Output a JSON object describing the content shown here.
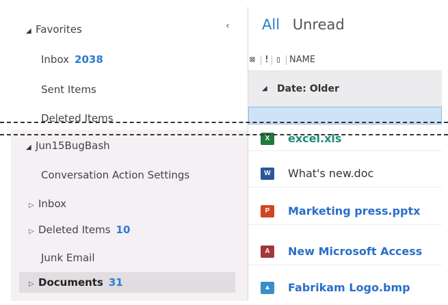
{
  "nav": {
    "collapse_glyph": "‹",
    "favorites_label": "Favorites",
    "items_top": [
      {
        "label": "Inbox",
        "count": "2038"
      },
      {
        "label": "Sent Items",
        "count": ""
      },
      {
        "label": "Deleted Items",
        "count": ""
      }
    ],
    "account_label": "Jun15BugBash",
    "items_bottom": [
      {
        "label": "Conversation Action Settings",
        "count": ""
      },
      {
        "label": "Inbox",
        "count": ""
      },
      {
        "label": "Deleted Items",
        "count": "10"
      },
      {
        "label": "Junk Email",
        "count": ""
      },
      {
        "label": "Documents",
        "count": "31"
      }
    ]
  },
  "list": {
    "tabs": {
      "all": "All",
      "unread": "Unread"
    },
    "columns": {
      "name": "NAME"
    },
    "group_label": "Date: Older",
    "files": [
      {
        "name": "excel.xls",
        "icon": "excel-icon",
        "bold": true
      },
      {
        "name": "What's new.doc",
        "icon": "word-icon",
        "bold": false
      },
      {
        "name": "Marketing press.pptx",
        "icon": "powerpoint-icon",
        "bold": true
      },
      {
        "name": "New Microsoft Access",
        "icon": "access-icon",
        "bold": true
      },
      {
        "name": "Fabrikam Logo.bmp",
        "icon": "image-icon",
        "bold": true
      }
    ]
  },
  "colors": {
    "accent": "#2a7dd1",
    "selected_row": "#cfe3f7"
  }
}
